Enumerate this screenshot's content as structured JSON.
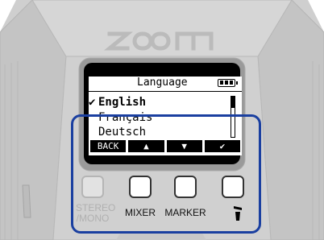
{
  "device": {
    "brand": "ZOOM",
    "colors": {
      "body": "#d2d2d2",
      "outline": "#aaaaaa",
      "screen_bezel": "#000000",
      "highlight": "#1a3fa0"
    }
  },
  "screen": {
    "title": "Language",
    "battery_icon": "battery-full-icon",
    "languages": [
      {
        "label": "English",
        "selected": true
      },
      {
        "label": "Français",
        "selected": false
      },
      {
        "label": "Deutsch",
        "selected": false
      }
    ],
    "selected_mark": "✔",
    "softkeys": [
      {
        "label": "BACK",
        "icon": ""
      },
      {
        "label": "▲",
        "icon": "up-arrow-icon"
      },
      {
        "label": "▼",
        "icon": "down-arrow-icon"
      },
      {
        "label": "✔",
        "icon": "check-icon"
      }
    ]
  },
  "buttons": {
    "stereo_mono": {
      "line1": "STEREO",
      "line2": "/MONO"
    },
    "mixer": "MIXER",
    "marker": "MARKER",
    "mic_icon": "microphone-icon"
  }
}
